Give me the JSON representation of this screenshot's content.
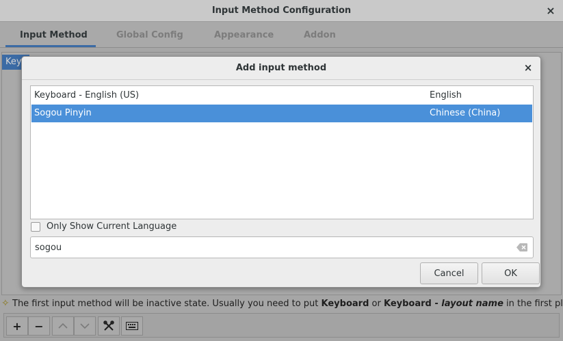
{
  "main_window": {
    "title": "Input Method Configuration",
    "close_glyph": "×",
    "tabs": [
      {
        "label": "Input Method",
        "active": true
      },
      {
        "label": "Global Config",
        "active": false
      },
      {
        "label": "Appearance",
        "active": false
      },
      {
        "label": "Addon",
        "active": false
      }
    ],
    "behind_row_text": "Keyboard",
    "hint": {
      "icon": "warning-icon",
      "prefix": "The first input method will be inactive state. Usually you need to put ",
      "bold1": "Keyboard",
      "middle": " or ",
      "bold2": "Keyboard - ",
      "italic": "layout name",
      "suffix": " in the first place."
    },
    "toolbar": {
      "add": "+",
      "remove": "−",
      "up": "∧",
      "down": "∨",
      "configure_icon": "tools-icon",
      "keyboard_icon": "keyboard-icon"
    }
  },
  "dialog": {
    "title": "Add input method",
    "close_glyph": "×",
    "list": [
      {
        "name": "Keyboard - English (US)",
        "language": "English",
        "selected": false
      },
      {
        "name": "Sogou Pinyin",
        "language": "Chinese (China)",
        "selected": true
      }
    ],
    "only_current_language": {
      "label": "Only Show Current Language",
      "checked": false
    },
    "search": {
      "value": "sogou"
    },
    "cancel_label": "Cancel",
    "ok_label": "OK"
  },
  "colors": {
    "selection": "#4a90d9",
    "accent": "#3b6ba5"
  }
}
